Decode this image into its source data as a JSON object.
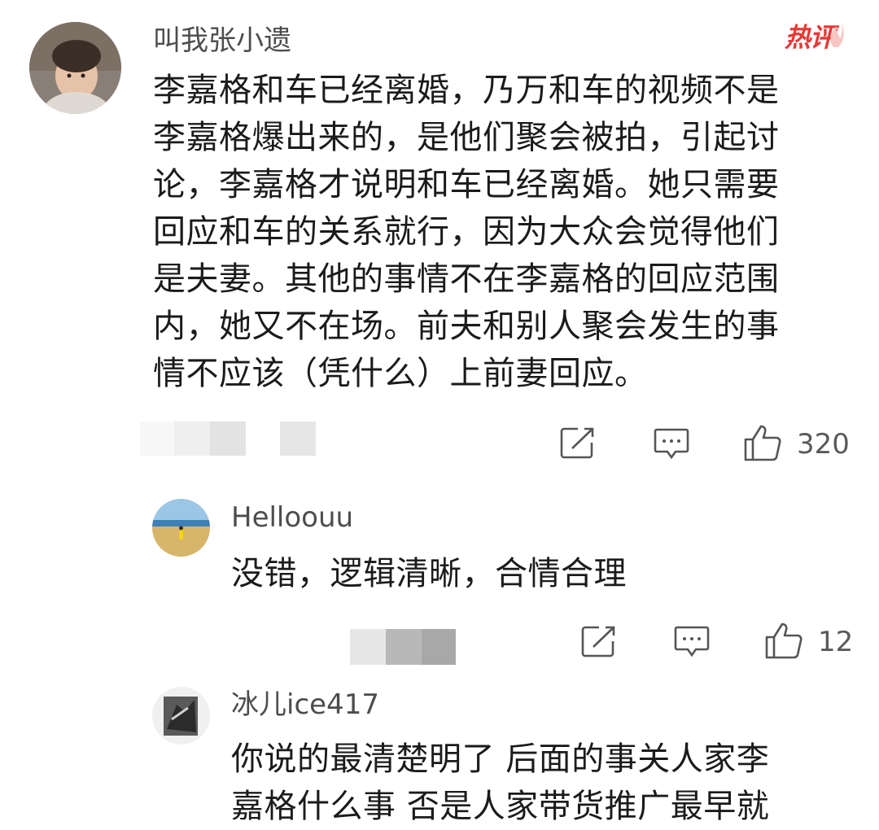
{
  "comments": [
    {
      "username": "叫我张小遗",
      "badge": "热评",
      "text_lines": [
        "李嘉格和车已经离婚，乃万和车的视频不是",
        "李嘉格爆出来的，是他们聚会被拍，引起讨",
        "论，李嘉格才说明和车已经离婚。她只需要",
        "回应和车的关系就行，因为大众会觉得他们",
        "是夫妻。其他的事情不在李嘉格的回应范围",
        "内，她又不在场。前夫和别人聚会发生的事",
        "情不应该（凭什么）上前妻回应。"
      ],
      "like_count": "320"
    },
    {
      "username": "Helloouu",
      "text": "没错，逻辑清晰，合情合理",
      "like_count": "12"
    },
    {
      "username": "冰儿ice417",
      "text_lines": [
        "你说的最清楚明了 后面的事关人家李",
        "嘉格什么事 否是人家带货推广最早就"
      ]
    }
  ],
  "icons": {
    "share": "share-icon",
    "reply": "comment-icon",
    "like": "thumbs-up-icon"
  }
}
